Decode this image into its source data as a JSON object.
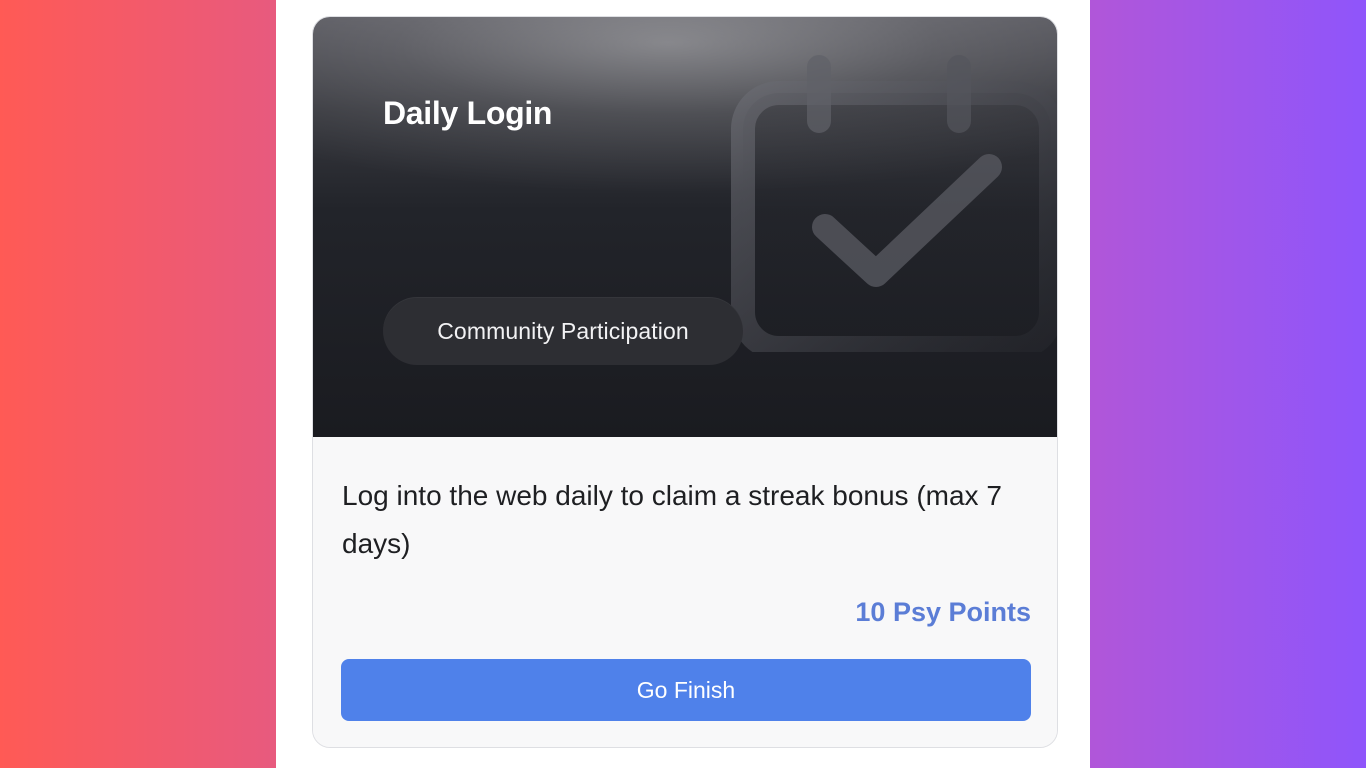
{
  "card": {
    "title": "Daily Login",
    "category": "Community Participation",
    "description": "Log into the web daily to claim a streak bonus (max 7 days)",
    "reward": "10 Psy Points",
    "action_label": "Go Finish",
    "icon": "calendar-check-icon"
  },
  "colors": {
    "left_background": "#ff5a55",
    "right_background": "#8f55fb",
    "accent_blue": "#4f81ea",
    "reward_blue": "#5b7dd6",
    "hero_dark": "#1a1b20"
  }
}
